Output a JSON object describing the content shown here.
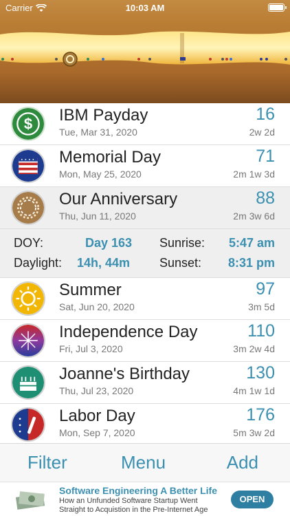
{
  "status_bar": {
    "carrier": "Carrier",
    "time": "10:03 AM"
  },
  "events": [
    {
      "title": "IBM Payday",
      "date": "Tue, Mar 31, 2020",
      "days": "16",
      "span": "2w 2d",
      "icon": "dollar-icon"
    },
    {
      "title": "Memorial Day",
      "date": "Mon, May 25, 2020",
      "days": "71",
      "span": "2m 1w 3d",
      "icon": "flag-shield-icon"
    },
    {
      "title": "Our Anniversary",
      "date": "Thu, Jun 11, 2020",
      "days": "88",
      "span": "2m 3w 6d",
      "icon": "laurel-wreath-icon",
      "selected": true
    },
    {
      "title": "Summer",
      "date": "Sat, Jun 20, 2020",
      "days": "97",
      "span": "3m 5d",
      "icon": "sun-icon"
    },
    {
      "title": "Independence Day",
      "date": "Fri, Jul 3, 2020",
      "days": "110",
      "span": "3m 2w 4d",
      "icon": "fireworks-icon"
    },
    {
      "title": "Joanne's Birthday",
      "date": "Thu, Jul 23, 2020",
      "days": "130",
      "span": "4m 1w 1d",
      "icon": "cake-icon"
    },
    {
      "title": "Labor Day",
      "date": "Mon, Sep 7, 2020",
      "days": "176",
      "span": "5m 3w 2d",
      "icon": "wrench-icon"
    }
  ],
  "detail": {
    "doy_label": "DOY:",
    "doy_value": "Day 163",
    "sunrise_label": "Sunrise:",
    "sunrise_value": "5:47 am",
    "daylight_label": "Daylight:",
    "daylight_value": "14h, 44m",
    "sunset_label": "Sunset:",
    "sunset_value": "8:31 pm"
  },
  "toolbar": {
    "filter_label": "Filter",
    "menu_label": "Menu",
    "add_label": "Add"
  },
  "ad": {
    "title": "Software Engineering A Better Life",
    "description": "How an Unfunded Software Startup Went Straight to Acquistion in the Pre-Internet Age",
    "button_label": "OPEN"
  },
  "colors": {
    "accent": "#3b8fb1",
    "header_gold": "#c38a43",
    "selected_row": "#efefef"
  }
}
